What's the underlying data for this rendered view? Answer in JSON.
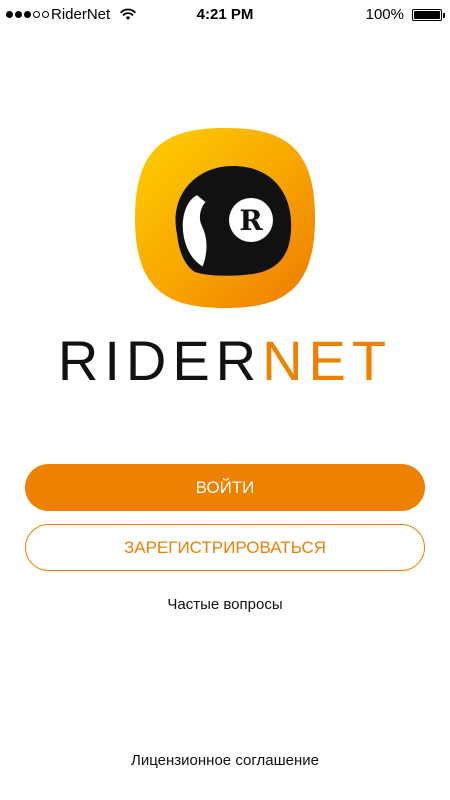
{
  "status_bar": {
    "carrier": "RiderNet",
    "time": "4:21 PM",
    "battery": "100%"
  },
  "brand": {
    "name_part1": "RIDER",
    "name_part2": "NET",
    "icon_letter": "R",
    "accent_color": "#f08000"
  },
  "actions": {
    "login_label": "ВОЙТИ",
    "register_label": "ЗАРЕГИСТРИРОВАТЬСЯ",
    "faq_label": "Частые вопросы",
    "license_label": "Лицензионное соглашение"
  }
}
